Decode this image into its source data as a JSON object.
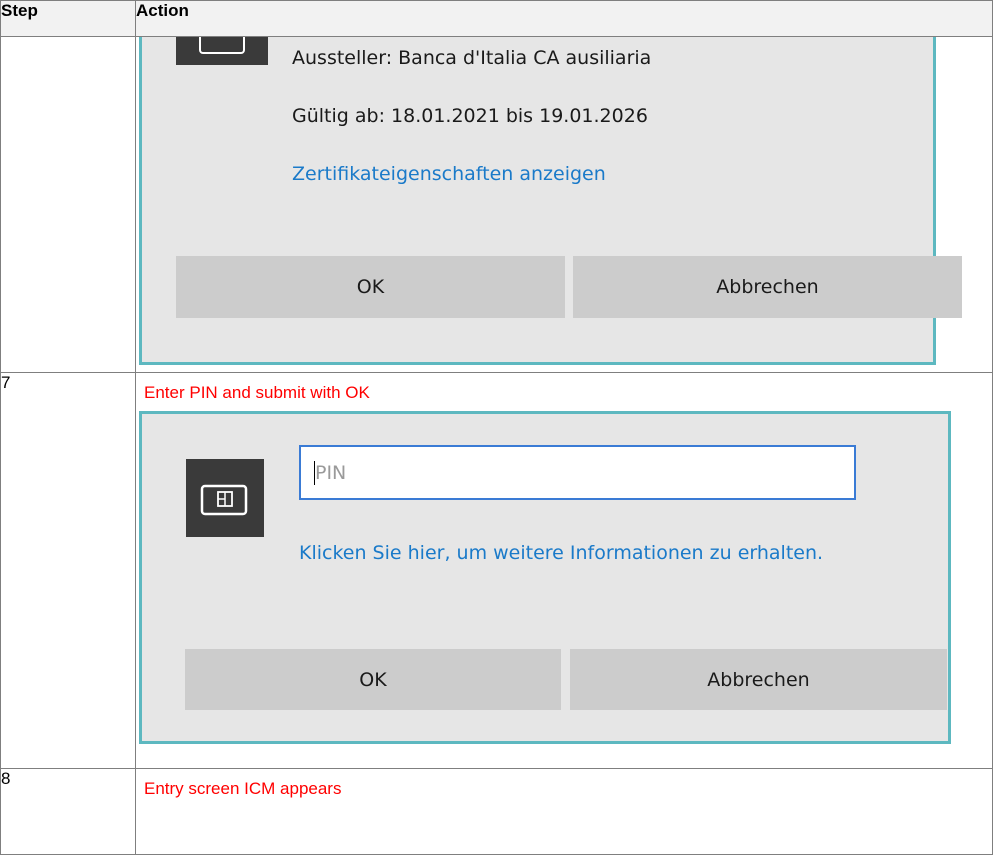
{
  "table": {
    "headers": {
      "step": "Step",
      "action": "Action"
    }
  },
  "row6": {
    "step": "",
    "dialog": {
      "issuer": "Aussteller: Banca d'Italia CA ausiliaria",
      "validity": "Gültig ab: 18.01.2021 bis 19.01.2026",
      "link": "Zertifikateigenschaften anzeigen",
      "ok_label": "OK",
      "cancel_label": "Abbrechen",
      "icon": "smartcard-icon"
    }
  },
  "row7": {
    "step": "7",
    "action": "Enter PIN and submit with OK",
    "dialog": {
      "pin_placeholder": "PIN",
      "info_link": "Klicken Sie hier, um weitere Informationen zu erhalten.",
      "ok_label": "OK",
      "cancel_label": "Abbrechen",
      "icon": "smartcard-icon"
    }
  },
  "row8": {
    "step": "8",
    "action": "Entry screen ICM appears"
  },
  "colors": {
    "action_text": "#ff0000",
    "dialog_border": "#5db8c0",
    "dialog_bg": "#e6e6e6",
    "link": "#1a7ac9",
    "button_bg": "#cccccc"
  }
}
